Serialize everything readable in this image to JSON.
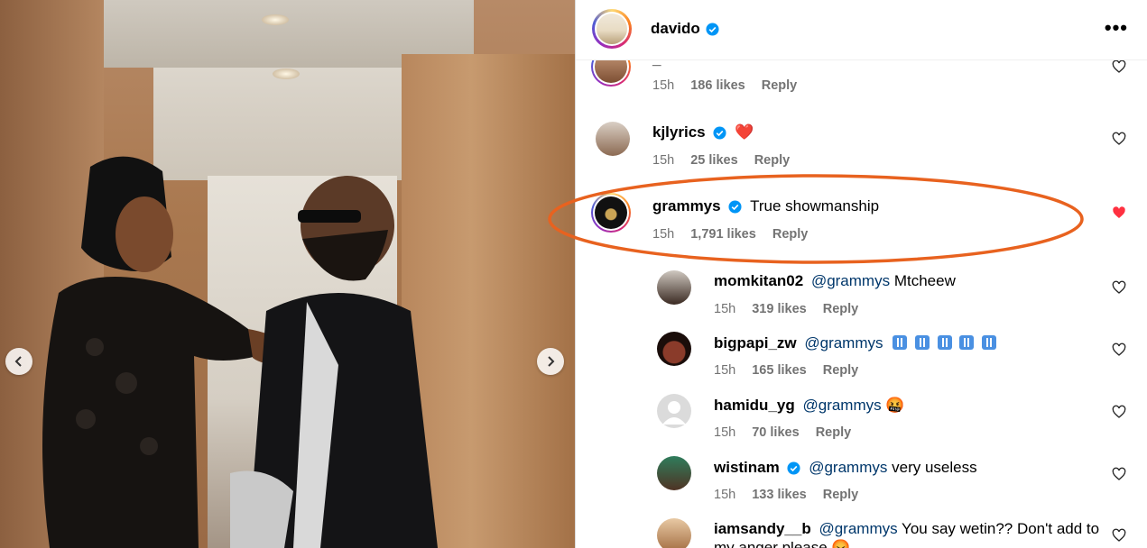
{
  "post": {
    "author": "davido",
    "author_verified": true
  },
  "comments": [
    {
      "user": "_",
      "text": "",
      "time": "15h",
      "likes": "186 likes",
      "reply": "Reply",
      "liked": false
    },
    {
      "user": "kjlyrics",
      "verified": true,
      "text": "❤️",
      "time": "15h",
      "likes": "25 likes",
      "reply": "Reply",
      "liked": false
    },
    {
      "user": "grammys",
      "verified": true,
      "text": "True showmanship",
      "time": "15h",
      "likes": "1,791 likes",
      "reply": "Reply",
      "liked": true,
      "highlighted": true
    }
  ],
  "replies": [
    {
      "user": "momkitan02",
      "mention": "@grammys",
      "text": "Mtcheew",
      "time": "15h",
      "likes": "319 likes",
      "reply": "Reply"
    },
    {
      "user": "bigpapi_zw",
      "mention": "@grammys",
      "text": "",
      "emoji_icons": [
        "person-toilet-icon",
        "person-toilet-icon",
        "person-toilet-icon",
        "person-toilet-icon",
        "person-toilet-icon"
      ],
      "time": "15h",
      "likes": "165 likes",
      "reply": "Reply"
    },
    {
      "user": "hamidu_yg",
      "mention": "@grammys",
      "text": "🤬",
      "time": "15h",
      "likes": "70 likes",
      "reply": "Reply"
    },
    {
      "user": "wistinam",
      "verified": true,
      "mention": "@grammys",
      "text": "very useless",
      "time": "15h",
      "likes": "133 likes",
      "reply": "Reply"
    },
    {
      "user": "iamsandy__b",
      "mention": "@grammys",
      "text": "You say wetin?? Don't add to",
      "text2": "my anger please 😡",
      "time": "",
      "likes": "",
      "reply": ""
    }
  ],
  "colors": {
    "highlight": "#e8621f",
    "verified": "#0095f6",
    "liked_heart": "#ff3040",
    "mention": "#00376b"
  }
}
